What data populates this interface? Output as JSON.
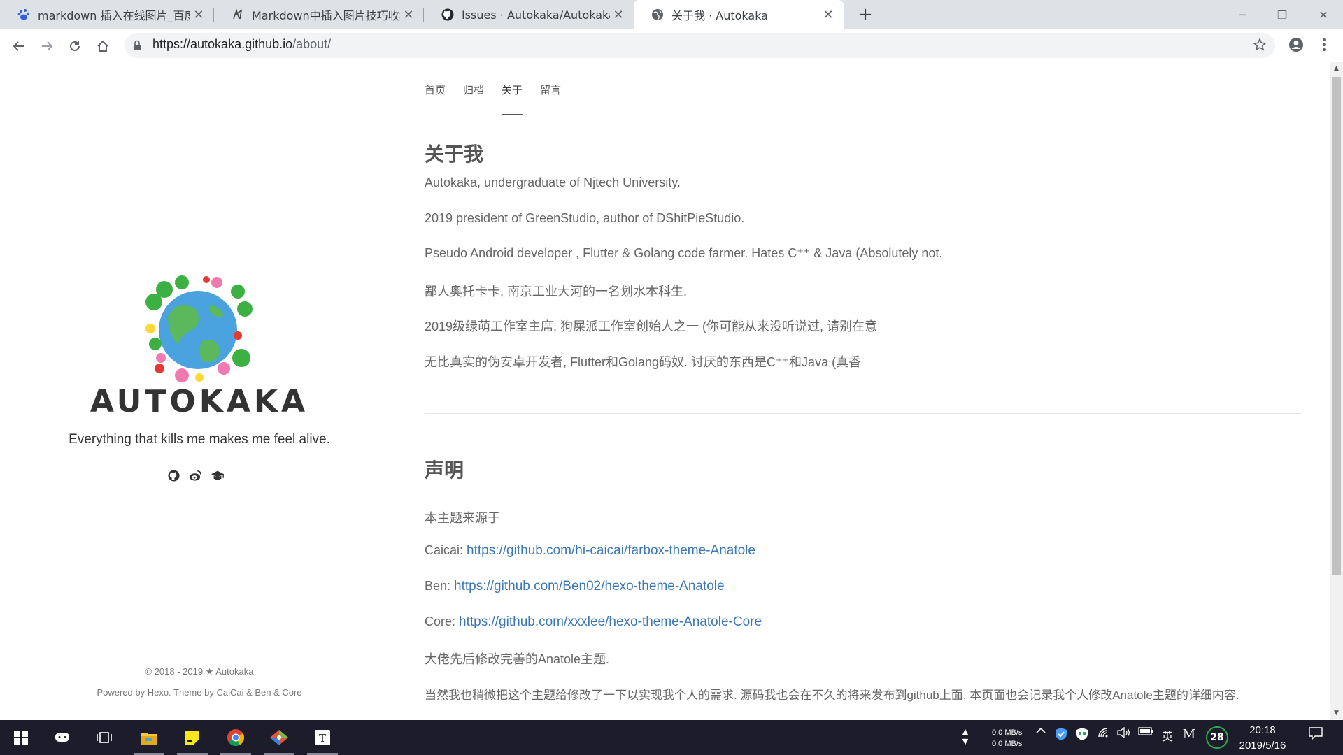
{
  "browser": {
    "tabs": [
      {
        "title": "markdown 插入在线图片_百度搜索",
        "favicon": "baidu-paw-icon"
      },
      {
        "title": "Markdown中插入图片技巧收集",
        "favicon": "bookmark-icon"
      },
      {
        "title": "Issues · Autokaka/Autokaka.github.io",
        "favicon": "github-icon"
      },
      {
        "title": "关于我 · Autokaka",
        "favicon": "globe-icon",
        "active": true
      }
    ],
    "new_tab": "+",
    "url_host": "https://autokaka.github.io",
    "url_path": "/about/"
  },
  "sidebar": {
    "site_title": "AUTOKAKA",
    "motto": "Everything that kills me makes me feel alive.",
    "social_icons": [
      "github-icon",
      "weibo-icon",
      "graduation-cap-icon"
    ],
    "footer_copyright": "© 2018 - 2019 ★ Autokaka",
    "footer_powered": "Powered by Hexo. Theme by CalCai & Ben & Core"
  },
  "nav": {
    "items": [
      "首页",
      "归档",
      "关于",
      "留言"
    ],
    "active": "关于"
  },
  "about": {
    "heading": "关于我",
    "lines": [
      "Autokaka, undergraduate of Njtech University.",
      "2019 president of GreenStudio, author of DShitPieStudio.",
      "Pseudo Android developer , Flutter & Golang code farmer. Hates C⁺⁺ & Java (Absolutely not.",
      "鄙人奥托卡卡, 南京工业大河的一名划水本科生.",
      "2019级绿萌工作室主席, 狗屎派工作室创始人之一 (你可能从来没听说过, 请别在意",
      "无比真实的伪安卓开发者, Flutter和Golang码奴. 讨厌的东西是C⁺⁺和Java (真香"
    ]
  },
  "statement": {
    "heading": "声明",
    "intro": "本主题来源于",
    "sources": [
      {
        "label": "Caicai: ",
        "link": "https://github.com/hi-caicai/farbox-theme-Anatole"
      },
      {
        "label": "Ben: ",
        "link": "https://github.com/Ben02/hexo-theme-Anatole"
      },
      {
        "label": "Core: ",
        "link": "https://github.com/xxxlee/hexo-theme-Anatole-Core"
      }
    ],
    "line1": "大佬先后修改完善的Anatole主题.",
    "line2": "当然我也稍微把这个主题给修改了一下以实现我个人的需求. 源码我也会在不久的将来发布到github上面, 本页面也会记录我个人修改Anatole主题的详细内容."
  },
  "taskbar": {
    "net_up": "0.0 MB/s",
    "net_down": "0.0 MB/s",
    "ime": "英",
    "badge": "28",
    "time": "20:18",
    "date": "2019/5/16"
  },
  "colors": {
    "link": "#3b78b8",
    "taskbar": "#1c1c2a",
    "tabstrip": "#dee1e6"
  }
}
